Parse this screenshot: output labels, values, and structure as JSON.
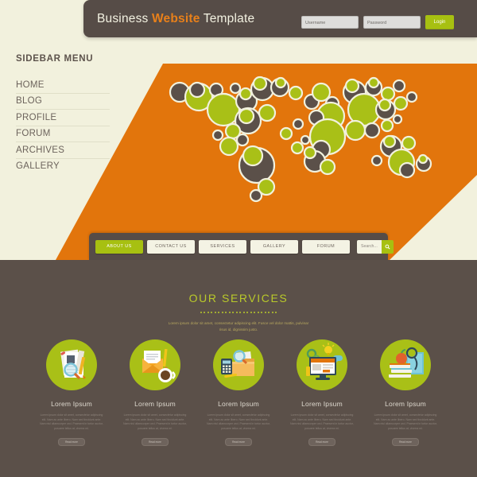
{
  "colors": {
    "page_bg": "#f2f1dd",
    "dark_brown": "#564c47",
    "section_brown": "#5b5049",
    "orange": "#e2750c",
    "green": "#a7c011",
    "olive_text": "#b9c92a",
    "accent_orange": "#e8801a"
  },
  "header": {
    "brand_prefix": "Business ",
    "brand_accent": "Website",
    "brand_suffix": " Template",
    "username_placeholder": "Username",
    "password_placeholder": "Password",
    "login_label": "Login"
  },
  "sidebar": {
    "title": "SIDEBAR MENU",
    "items": [
      {
        "label": "HOME"
      },
      {
        "label": "BLOG"
      },
      {
        "label": "PROFILE"
      },
      {
        "label": "FORUM"
      },
      {
        "label": "ARCHIVES"
      },
      {
        "label": "GALLERY"
      }
    ]
  },
  "hero": {
    "graphic": "world-map-circles",
    "map_circle_green": "#a9c017",
    "map_circle_dark": "#5b5049",
    "map_circle_outline": "#f2f1dd"
  },
  "nav": {
    "items": [
      {
        "label": "ABOUT US",
        "active": true
      },
      {
        "label": "CONTACT US",
        "active": false
      },
      {
        "label": "SERVICES",
        "active": false
      },
      {
        "label": "GALLERY",
        "active": false
      },
      {
        "label": "FORUM",
        "active": false
      }
    ],
    "search_placeholder": "Search...",
    "search_icon": "search-icon"
  },
  "services": {
    "title": "OUR SERVICES",
    "subtitle": "Lorem ipsum dolor sit amet, consectetur adipiscing elit. Fusce vel dolor mattis, pulvinar risus id, dignissim justo.",
    "dot_count": 22,
    "cards": [
      {
        "icon": "document-magnifier-icon",
        "title": "Lorem Ipsum",
        "body": "Lorem ipsum dolor sit amet, consectetur adipiscing elit. Nam ac ante libero. Nam sed tincidunt ante. Nam nisl ullamcorper orci. Praesent in tortor auctor, posuere tellus at, viverra mi.",
        "button": "Read more"
      },
      {
        "icon": "envelope-coffee-icon",
        "title": "Lorem Ipsum",
        "body": "Lorem ipsum dolor sit amet, consectetur adipiscing elit. Nam ac ante libero. Nam sed tincidunt ante. Nam nisl ullamcorper orci. Praesent in tortor auctor, posuere tellus at, viverra mi.",
        "button": "Read more"
      },
      {
        "icon": "calculator-folder-icon",
        "title": "Lorem Ipsum",
        "body": "Lorem ipsum dolor sit amet, consectetur adipiscing elit. Nam ac ante libero. Nam sed tincidunt ante. Nam nisl ullamcorper orci. Praesent in tortor auctor, posuere tellus at, viverra mi.",
        "button": "Read more"
      },
      {
        "icon": "monitor-webdesign-icon",
        "title": "Lorem Ipsum",
        "body": "Lorem ipsum dolor sit amet, consectetur adipiscing elit. Nam ac ante libero. Nam sed tincidunt ante. Nam nisl ullamcorper orci. Praesent in tortor auctor, posuere tellus at, viverra mi.",
        "button": "Read more"
      },
      {
        "icon": "books-education-icon",
        "title": "Lorem Ipsum",
        "body": "Lorem ipsum dolor sit amet, consectetur adipiscing elit. Nam ac ante libero. Nam sed tincidunt ante. Nam nisl ullamcorper orci. Praesent in tortor auctor, posuere tellus at, viverra mi.",
        "button": "Read more"
      }
    ]
  }
}
